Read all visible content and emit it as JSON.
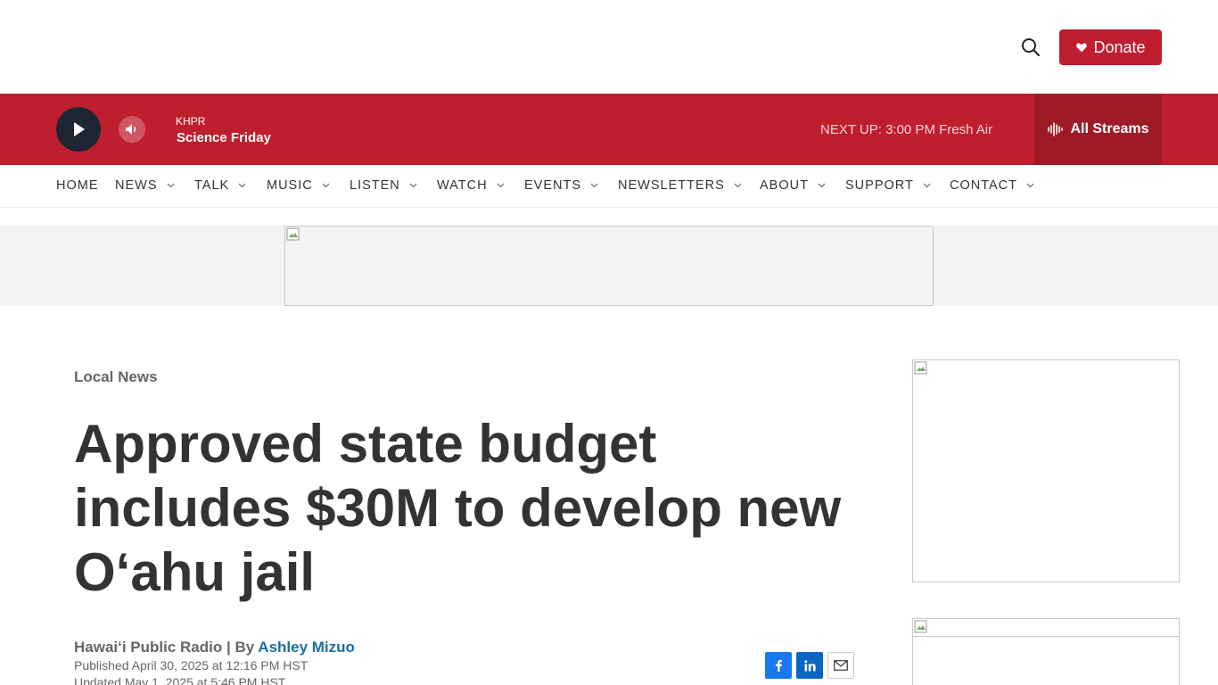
{
  "header": {
    "donate_label": "Donate",
    "icons": {
      "search": "search-icon",
      "heart": "heart-icon"
    }
  },
  "player": {
    "station": "KHPR",
    "program": "Science Friday",
    "next_up": "NEXT UP: 3:00 PM Fresh Air",
    "all_streams_label": "All Streams",
    "icons": {
      "play": "play-icon",
      "volume": "volume-icon",
      "waveform": "waveform-icon"
    }
  },
  "nav": {
    "items": [
      {
        "label": "HOME"
      },
      {
        "label": "NEWS"
      },
      {
        "label": "TALK"
      },
      {
        "label": "MUSIC"
      },
      {
        "label": "LISTEN"
      },
      {
        "label": "WATCH"
      },
      {
        "label": "EVENTS"
      },
      {
        "label": "NEWSLETTERS"
      },
      {
        "label": "ABOUT"
      },
      {
        "label": "SUPPORT"
      },
      {
        "label": "CONTACT"
      }
    ]
  },
  "article": {
    "category": "Local News",
    "headline": "Approved state budget includes $30M to develop new O‘ahu jail",
    "source": "Hawaiʻi Public Radio | By",
    "author": "Ashley Mizuo",
    "published": "Published April 30, 2025 at 12:16 PM HST",
    "updated": "Updated May 1, 2025 at 5:46 PM HST"
  },
  "share": {
    "icons": {
      "facebook": "facebook-icon",
      "linkedin": "linkedin-icon",
      "email": "email-icon"
    }
  },
  "colors": {
    "brand_red": "#bf1e2e",
    "streams_dark_red": "#9e1a25",
    "play_button": "#1e2633",
    "author_link": "#1a6ea0"
  }
}
